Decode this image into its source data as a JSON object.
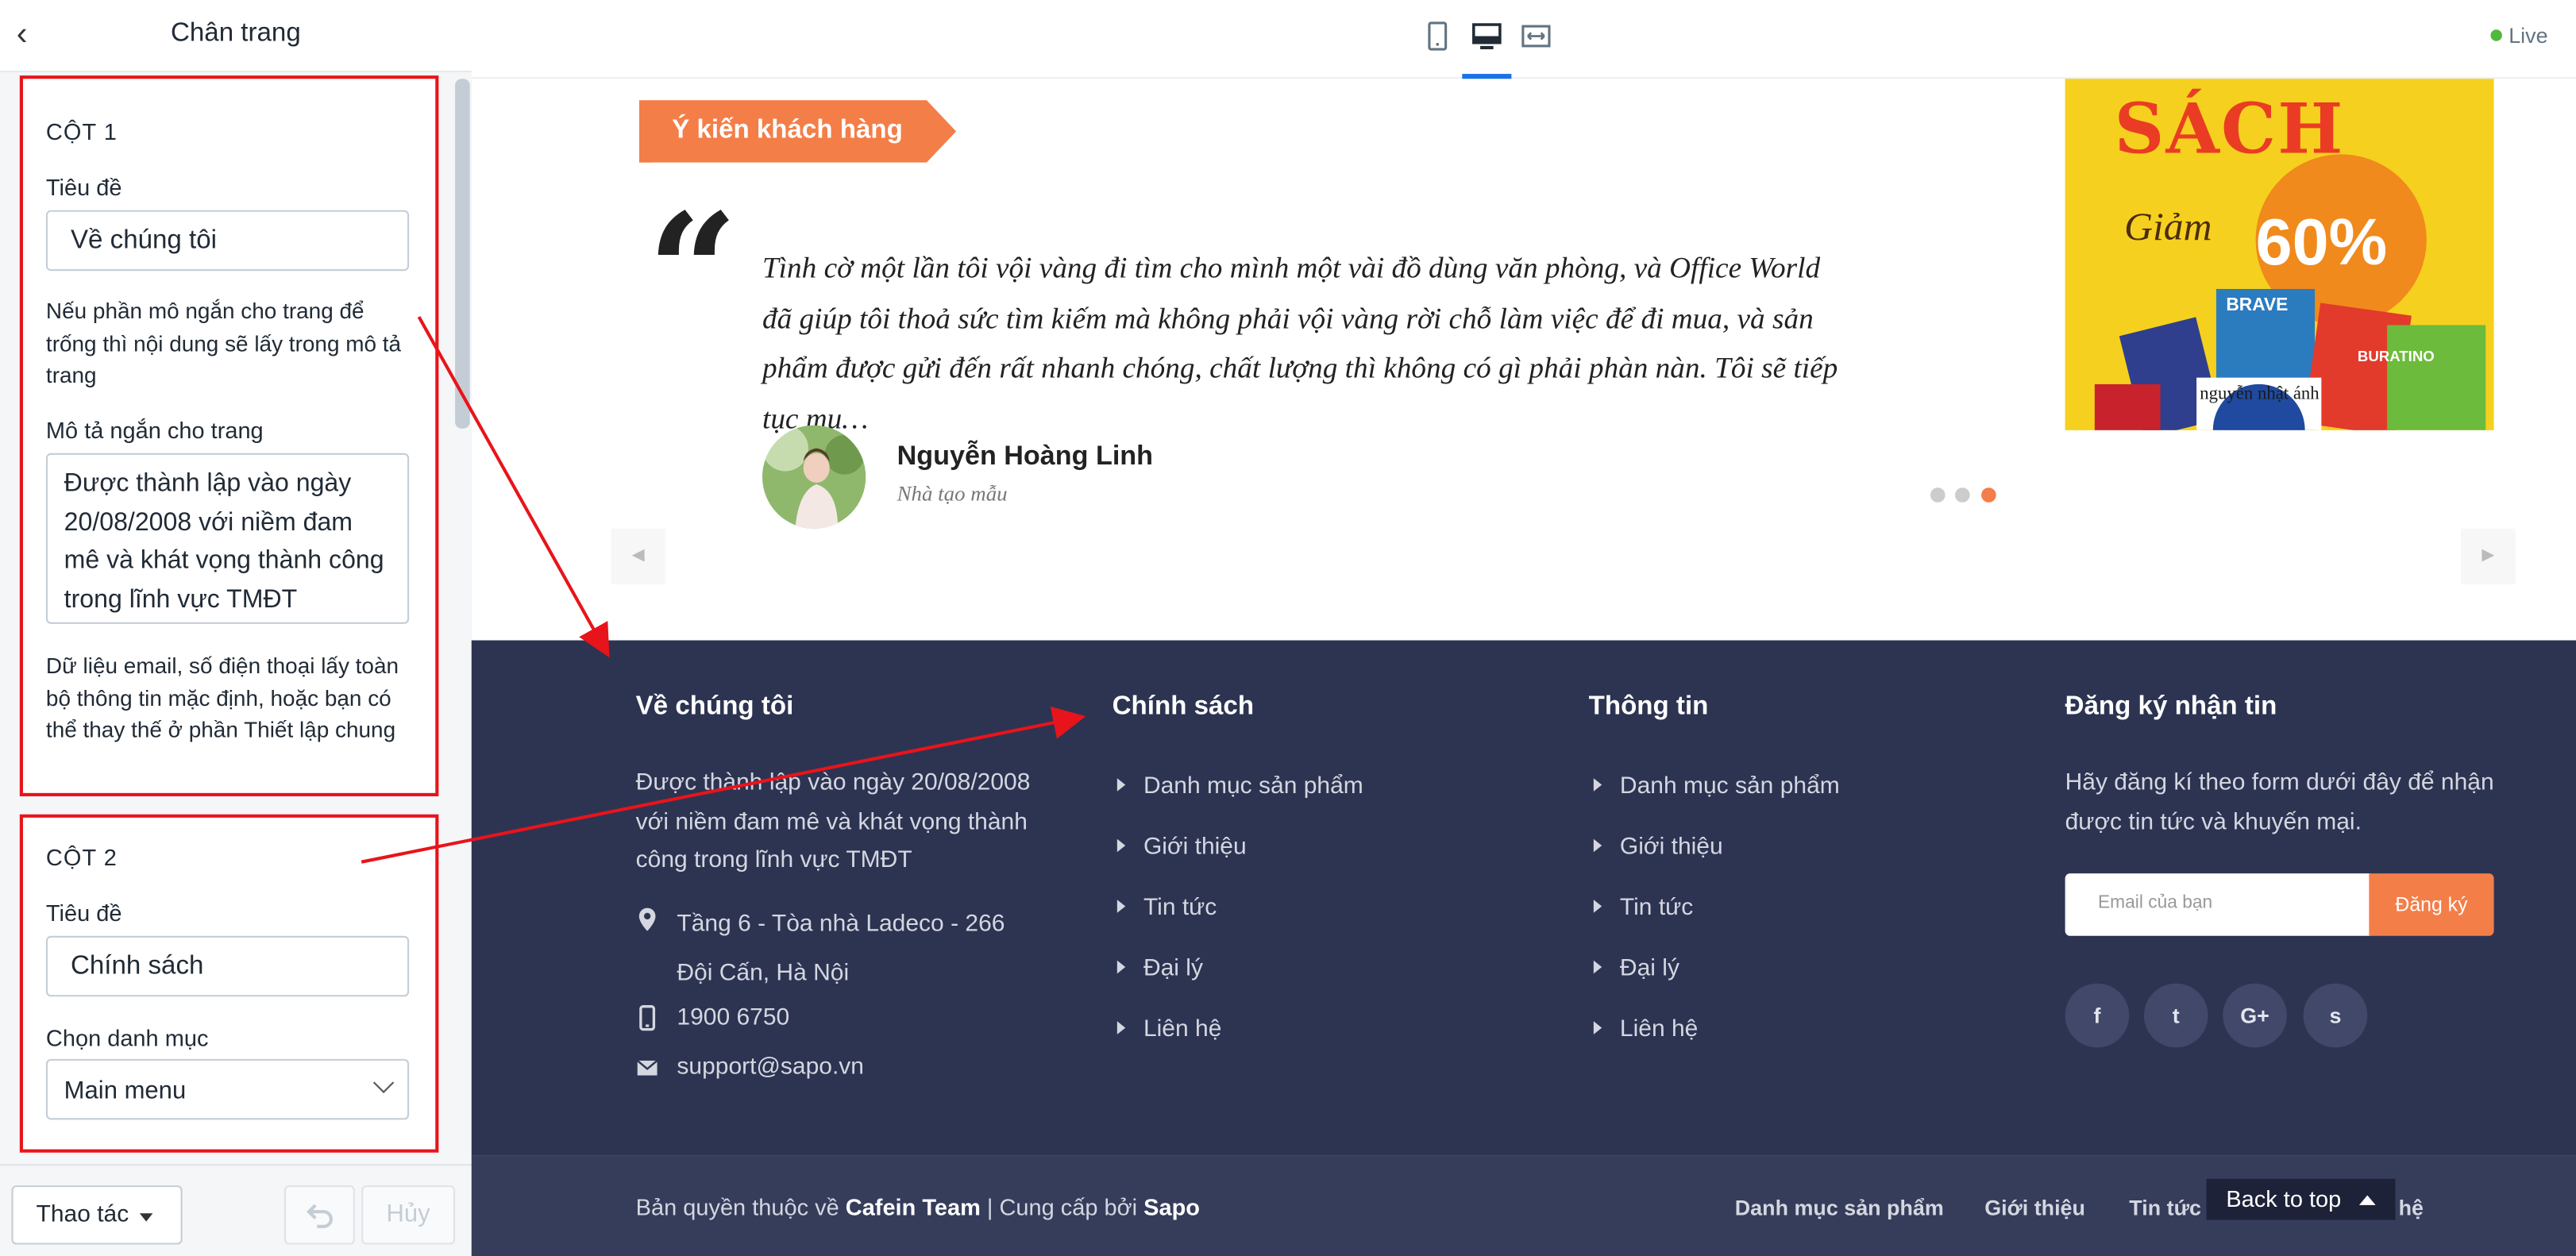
{
  "sidebar": {
    "title": "Chân trang",
    "col1": {
      "heading": "CỘT 1",
      "title_label": "Tiêu đề",
      "title_value": "Về chúng tôi",
      "help1": "Nếu phần mô ngắn cho trang để trống thì nội dung sẽ lấy trong mô tả trang",
      "desc_label": "Mô tả ngắn cho trang",
      "desc_value": "Được thành lập vào ngày 20/08/2008 với niềm đam mê và khát vọng thành công trong lĩnh vực TMĐT",
      "help2": "Dữ liệu email, số điện thoại lấy toàn bộ thông tin mặc định, hoặc bạn có thể thay thế ở phần Thiết lập chung"
    },
    "col2": {
      "heading": "CỘT 2",
      "title_label": "Tiêu đề",
      "title_value": "Chính sách",
      "menu_label": "Chọn danh mục",
      "menu_value": "Main menu"
    },
    "actions_label": "Thao tác",
    "cancel_label": "Hủy"
  },
  "topbar": {
    "live_label": "Live"
  },
  "testimonial": {
    "section_title": "Ý kiến khách hàng",
    "text": "Tình cờ một lần tôi vội vàng đi tìm cho mình một vài đồ dùng văn phòng, và Office World đã giúp tôi thoả sức tìm kiếm mà không phải vội vàng rời chỗ làm việc để đi mua, và sản phẩm được gửi đến rất nhanh chóng, chất lượng thì không có gì phải phàn nàn. Tôi sẽ tiếp tục mu…",
    "name": "Nguyễn Hoàng Linh",
    "role": "Nhà tạo mẫu",
    "active_slide": 3,
    "slide_count": 3
  },
  "promo": {
    "headline": "SÁCH",
    "sub": "Giảm",
    "discount": "60%",
    "book_brand": "BRAVE",
    "book_author": "nguyễn nhật ánh",
    "book_title": "BURATINO"
  },
  "footer": {
    "col1": {
      "title": "Về chúng tôi",
      "desc": "Được thành lập vào ngày 20/08/2008 với niềm đam mê và khát vọng thành công trong lĩnh vực TMĐT",
      "address": "Tầng 6 - Tòa nhà Ladeco - 266 Đội Cấn, Hà Nội",
      "phone": "1900 6750",
      "email": "support@sapo.vn"
    },
    "col2": {
      "title": "Chính sách",
      "links": [
        "Danh mục sản phẩm",
        "Giới thiệu",
        "Tin tức",
        "Đại lý",
        "Liên hệ"
      ]
    },
    "col3": {
      "title": "Thông tin",
      "links": [
        "Danh mục sản phẩm",
        "Giới thiệu",
        "Tin tức",
        "Đại lý",
        "Liên hệ"
      ]
    },
    "col4": {
      "title": "Đăng ký nhận tin",
      "desc": "Hãy đăng kí theo form dưới đây để nhận được tin tức và khuyến mại.",
      "email_placeholder": "Email của bạn",
      "subscribe_label": "Đăng ký",
      "social": [
        "f",
        "t",
        "G+",
        "s"
      ]
    },
    "bottom": {
      "copyright_prefix": "Bản quyền thuộc về",
      "team": "Cafein Team",
      "sep": "| Cung cấp bởi",
      "provider": "Sapo",
      "links": [
        "Danh mục sản phẩm",
        "Giới thiệu",
        "Tin tức",
        "hệ"
      ],
      "back_to_top": "Back to top"
    }
  },
  "colors": {
    "accent": "#f47e48",
    "footer_bg": "#2d3452",
    "annotation": "#e8141b",
    "active_tab": "#1a73e8"
  }
}
